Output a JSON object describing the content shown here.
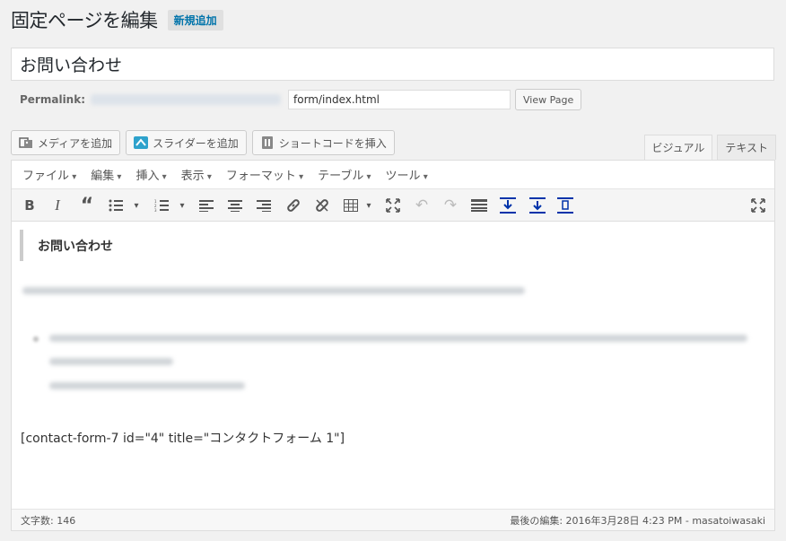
{
  "header": {
    "title": "固定ページを編集",
    "add_new": "新規追加"
  },
  "post": {
    "title": "お問い合わせ"
  },
  "permalink": {
    "label": "Permalink:",
    "slug_value": "form/index.html",
    "view_button": "View Page"
  },
  "media_buttons": [
    {
      "label": "メディアを追加",
      "icon": "media-icon"
    },
    {
      "label": "スライダーを追加",
      "icon": "slider-icon"
    },
    {
      "label": "ショートコードを挿入",
      "icon": "shortcode-icon"
    }
  ],
  "tabs": {
    "visual": "ビジュアル",
    "text": "テキスト"
  },
  "menubar": [
    "ファイル",
    "編集",
    "挿入",
    "表示",
    "フォーマット",
    "テーブル",
    "ツール"
  ],
  "toolbar_icons": [
    "bold-icon",
    "italic-icon",
    "blockquote-icon",
    "bullet-list-icon",
    "numbered-list-icon",
    "align-left-icon",
    "align-center-icon",
    "align-right-icon",
    "link-icon",
    "unlink-icon",
    "table-icon",
    "fullscreen-icon",
    "undo-icon",
    "redo-icon",
    "toolbar-toggle-icon",
    "insert-before-icon",
    "insert-after-icon",
    "insert-page-break-icon",
    "distraction-free-icon"
  ],
  "content": {
    "heading": "お問い合わせ",
    "shortcode": "[contact-form-7 id=\"4\" title=\"コンタクトフォーム 1\"]"
  },
  "status": {
    "word_count": "文字数: 146",
    "last_edit": "最後の編集: 2016年3月28日 4:23 PM - masatoiwasaki"
  },
  "colors": {
    "link": "#0073aa",
    "background": "#f1f1f1"
  }
}
